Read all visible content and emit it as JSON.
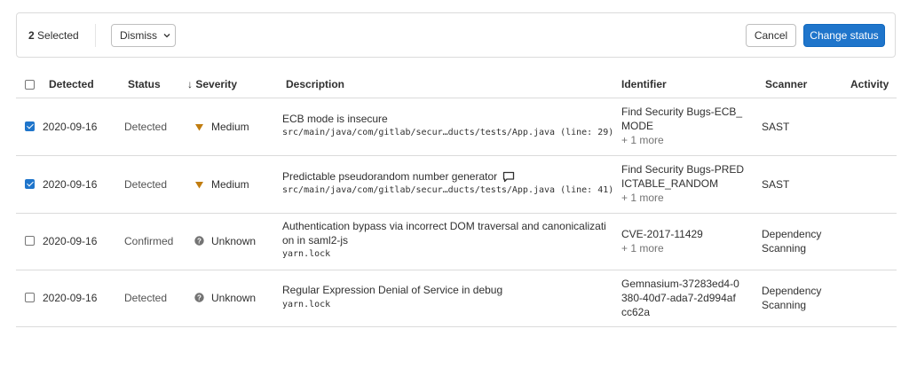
{
  "selection": {
    "count": "2",
    "label": "Selected",
    "dismiss_label": "Dismiss",
    "cancel_label": "Cancel",
    "change_status_label": "Change status"
  },
  "table": {
    "columns": {
      "detected": "Detected",
      "status": "Status",
      "severity": "Severity",
      "description": "Description",
      "identifier": "Identifier",
      "scanner": "Scanner",
      "activity": "Activity"
    },
    "sort_indicator": "↓",
    "rows": [
      {
        "checked": true,
        "date": "2020-09-16",
        "status": "Detected",
        "severity": "Medium",
        "severity_icon": "triangle-down-icon",
        "title": "ECB mode is insecure",
        "location": "src/main/java/com/gitlab/secur…ducts/tests/App.java (line: 29)",
        "identifier": [
          "Find Security Bugs-ECB_",
          "MODE"
        ],
        "more": "+ 1 more",
        "scanner": [
          "SAST"
        ]
      },
      {
        "checked": true,
        "date": "2020-09-16",
        "status": "Detected",
        "severity": "Medium",
        "severity_icon": "triangle-down-icon",
        "title": "Predictable pseudorandom number generator",
        "location": "src/main/java/com/gitlab/secur…ducts/tests/App.java (line: 41)",
        "identifier": [
          "Find Security Bugs-PRED",
          "ICTABLE_RANDOM"
        ],
        "more": "+ 1 more",
        "scanner": [
          "SAST"
        ],
        "has_comment": true
      },
      {
        "checked": false,
        "date": "2020-09-16",
        "status": "Confirmed",
        "severity": "Unknown",
        "severity_icon": "question-circle-icon",
        "title": [
          "Authentication bypass via incorrect DOM traversal and canonicalizati",
          "on in saml2-js"
        ],
        "location": "yarn.lock",
        "identifier": [
          "CVE-2017-11429"
        ],
        "more": "+ 1 more",
        "scanner": [
          "Dependency",
          "Scanning"
        ]
      },
      {
        "checked": false,
        "date": "2020-09-16",
        "status": "Detected",
        "severity": "Unknown",
        "severity_icon": "question-circle-icon",
        "title": "Regular Expression Denial of Service in debug",
        "location": "yarn.lock",
        "identifier": [
          "Gemnasium-37283ed4-0",
          "380-40d7-ada7-2d994af",
          "cc62a"
        ],
        "scanner": [
          "Dependency",
          "Scanning"
        ]
      }
    ]
  },
  "colors": {
    "primary": "#1f75cb",
    "medium_severity": "#c17d10",
    "unknown_severity": "#737373",
    "border": "#dbdbdb"
  }
}
